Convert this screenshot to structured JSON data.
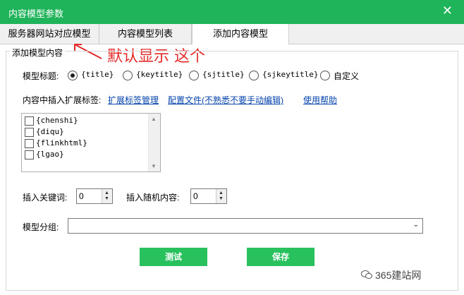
{
  "window": {
    "title": "内容模型参数",
    "close_glyph": "✕"
  },
  "tabs": [
    {
      "label": "服务器网站对应模型"
    },
    {
      "label": "内容模型列表"
    },
    {
      "label": "添加内容模型",
      "active": true
    }
  ],
  "annotation": {
    "text": "默认显示 这个",
    "color": "#e52a2a"
  },
  "group": {
    "title": "添加模型内容"
  },
  "model_title": {
    "label": "模型标题:",
    "options": [
      "{title}",
      "{keytitle}",
      "{sjtitle}",
      "{sjkeytitle}",
      "自定义"
    ],
    "selected": "{title}"
  },
  "insert_tags": {
    "label": "内容中插入扩展标签:",
    "links": [
      "扩展标签管理",
      "配置文件(不熟悉不要手动编辑)",
      "使用帮助"
    ]
  },
  "tag_list": [
    "{chenshi}",
    "{diqu}",
    "{flinkhtml}",
    "{lgao}"
  ],
  "keywords": {
    "label": "插入关键词:",
    "value": "0"
  },
  "random_content": {
    "label": "插入随机内容:",
    "value": "0"
  },
  "model_group": {
    "label": "模型分组:",
    "value": ""
  },
  "buttons": {
    "test": "测试",
    "save": "保存"
  },
  "watermark": {
    "text": "365建站网"
  },
  "colors": {
    "accent": "#1fb35a",
    "button": "#28c15e",
    "link": "#0645ad"
  }
}
